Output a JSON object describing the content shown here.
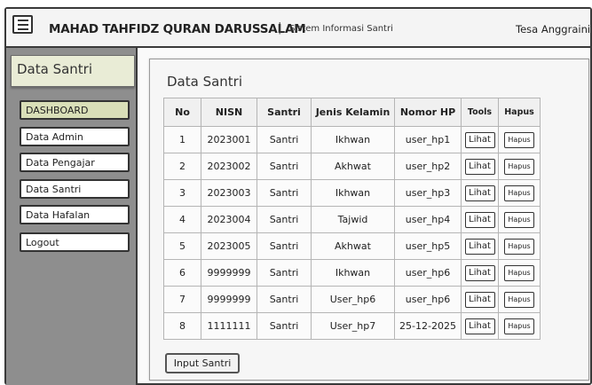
{
  "header": {
    "title": "MAHAD TAHFIDZ QURAN DARUSSALAM",
    "separator": "|",
    "subtitle": "Sistem Informasi Santri",
    "user": "Tesa Anggraini"
  },
  "sidebar": {
    "title": "Data Santri",
    "items": [
      {
        "label": "DASHBOARD",
        "active": true
      },
      {
        "label": "Data Admin",
        "active": false
      },
      {
        "label": "Data Pengajar",
        "active": false
      },
      {
        "label": "Data Santri",
        "active": false
      },
      {
        "label": "Data Hafalan",
        "active": false
      },
      {
        "label": "Logout",
        "active": false
      }
    ]
  },
  "main": {
    "title": "Data Santri",
    "columns": [
      "No",
      "NISN",
      "Santri",
      "Jenis Kelamin",
      "Nomor HP",
      "Tools",
      "Hapus"
    ],
    "rows": [
      {
        "no": "1",
        "nisn": "2023001",
        "santri": "Santri",
        "jenis_kelamin": "Ikhwan",
        "nomor_hp": "user_hp1",
        "tools": "Lihat",
        "hapus": "Hapus"
      },
      {
        "no": "2",
        "nisn": "2023002",
        "santri": "Santri",
        "jenis_kelamin": "Akhwat",
        "nomor_hp": "user_hp2",
        "tools": "Lihat",
        "hapus": "Hapus"
      },
      {
        "no": "3",
        "nisn": "2023003",
        "santri": "Santri",
        "jenis_kelamin": "Ikhwan",
        "nomor_hp": "user_hp3",
        "tools": "Lihat",
        "hapus": "Hapus"
      },
      {
        "no": "4",
        "nisn": "2023004",
        "santri": "Santri",
        "jenis_kelamin": "Tajwid",
        "nomor_hp": "user_hp4",
        "tools": "Lihat",
        "hapus": "Hapus"
      },
      {
        "no": "5",
        "nisn": "2023005",
        "santri": "Santri",
        "jenis_kelamin": "Akhwat",
        "nomor_hp": "user_hp5",
        "tools": "Lihat",
        "hapus": "Hapus"
      },
      {
        "no": "6",
        "nisn": "9999999",
        "santri": "Santri",
        "jenis_kelamin": "Ikhwan",
        "nomor_hp": "user_hp6",
        "tools": "Lihat",
        "hapus": "Hapus"
      },
      {
        "no": "7",
        "nisn": "9999999",
        "santri": "Santri",
        "jenis_kelamin": "User_hp6",
        "nomor_hp": "user_hp6",
        "tools": "Lihat",
        "hapus": "Hapus"
      },
      {
        "no": "8",
        "nisn": "1111111",
        "santri": "Santri",
        "jenis_kelamin": "User_hp7",
        "nomor_hp": "25-12-2025",
        "tools": "Lihat",
        "hapus": "Hapus"
      }
    ],
    "input_button": "Input Santri"
  },
  "icons": {
    "menu": "hamburger-menu-icon"
  },
  "colors": {
    "sidebar_bg": "#8e8e8e",
    "active_item": "#d9dfb8",
    "sidebar_title_bg": "#e9ecd6"
  }
}
